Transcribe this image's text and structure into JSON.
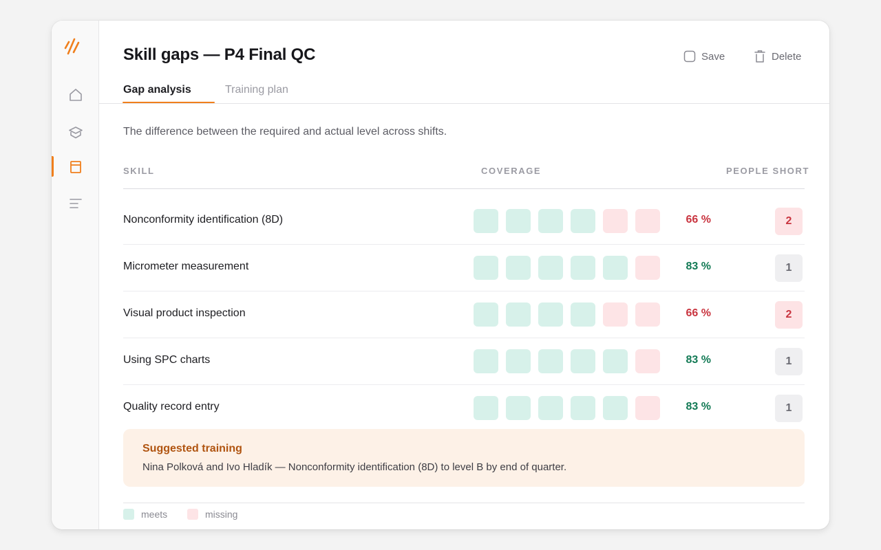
{
  "app": {
    "title": "Skill gaps — P4 Final QC",
    "save_label": "Save",
    "delete_label": "Delete"
  },
  "sidebar": {
    "items": [
      {
        "icon": "home-icon",
        "active": false
      },
      {
        "icon": "layers-icon",
        "active": false
      },
      {
        "icon": "calendar-icon",
        "active": true
      },
      {
        "icon": "list-icon",
        "active": false
      }
    ]
  },
  "tabs": [
    {
      "label": "Gap analysis",
      "active": true
    },
    {
      "label": "Training plan",
      "active": false
    }
  ],
  "description": "The difference between the required and actual level across shifts.",
  "columns": {
    "skill": "SKILL",
    "coverage": "COVERAGE",
    "people_short": "PEOPLE SHORT"
  },
  "rows": [
    {
      "skill": "Nonconformity identification (8D)",
      "cells": [
        "meets",
        "meets",
        "meets",
        "meets",
        "missing",
        "missing"
      ],
      "pct": "66 %",
      "status": "low",
      "short": "2"
    },
    {
      "skill": "Micrometer measurement",
      "cells": [
        "meets",
        "meets",
        "meets",
        "meets",
        "meets",
        "missing"
      ],
      "pct": "83 %",
      "status": "ok",
      "short": "1"
    },
    {
      "skill": "Visual product inspection",
      "cells": [
        "meets",
        "meets",
        "meets",
        "meets",
        "missing",
        "missing"
      ],
      "pct": "66 %",
      "status": "low",
      "short": "2"
    },
    {
      "skill": "Using SPC charts",
      "cells": [
        "meets",
        "meets",
        "meets",
        "meets",
        "meets",
        "missing"
      ],
      "pct": "83 %",
      "status": "ok",
      "short": "1"
    },
    {
      "skill": "Quality record entry",
      "cells": [
        "meets",
        "meets",
        "meets",
        "meets",
        "meets",
        "missing"
      ],
      "pct": "83 %",
      "status": "ok",
      "short": "1"
    }
  ],
  "suggestion": {
    "title": "Suggested training",
    "body": "Nina Polková and Ivo Hladík — Nonconformity identification (8D) to level B by end of quarter."
  },
  "legend": {
    "meets": "meets",
    "missing": "missing"
  },
  "colors": {
    "accent": "#f07f1c",
    "meets": "#d7f1ea",
    "missing": "#fde4e6",
    "low_text": "#c9343f",
    "ok_text": "#137a55"
  }
}
